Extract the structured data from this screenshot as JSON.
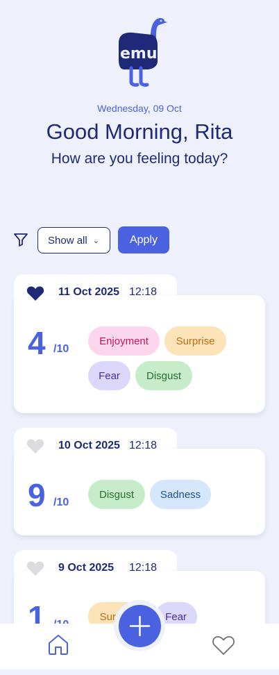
{
  "header": {
    "logo_text": "emu",
    "date": "Wednesday, 09 Oct",
    "greeting": "Good Morning, Rita",
    "question": "How are you feeling today?"
  },
  "filter": {
    "icon": "filter-icon",
    "select_value": "Show all",
    "apply_label": "Apply"
  },
  "entries": [
    {
      "favorite": true,
      "date": "11 Oct 2025",
      "time": "12:18",
      "score": "4",
      "out_of": "/10",
      "emotions": [
        "Enjoyment",
        "Surprise",
        "Fear",
        "Disgust"
      ]
    },
    {
      "favorite": false,
      "date": "10 Oct 2025",
      "time": "12:18",
      "score": "9",
      "out_of": "/10",
      "emotions": [
        "Disgust",
        "Sadness"
      ]
    },
    {
      "favorite": false,
      "date": "9 Oct 2025",
      "time": "12:18",
      "score": "1",
      "out_of": "/10",
      "emotions": [
        "Surprise",
        "Fear"
      ]
    }
  ],
  "emotion_colors": {
    "Enjoyment": {
      "bg": "#fcd6ec",
      "fg": "#c2185b"
    },
    "Surprise": {
      "bg": "#fde3b8",
      "fg": "#c06a12"
    },
    "Fear": {
      "bg": "#dcd8fb",
      "fg": "#4b2bb0"
    },
    "Disgust": {
      "bg": "#c7ecc9",
      "fg": "#2a6f32"
    },
    "Sadness": {
      "bg": "#d5e8fb",
      "fg": "#1f4f9e"
    }
  },
  "nav": {
    "home_icon": "home-icon",
    "add_icon": "plus-icon",
    "favorites_icon": "heart-outline-icon"
  },
  "colors": {
    "accent": "#4a62e0",
    "navy": "#1e2a78",
    "background": "#eef1fb"
  }
}
